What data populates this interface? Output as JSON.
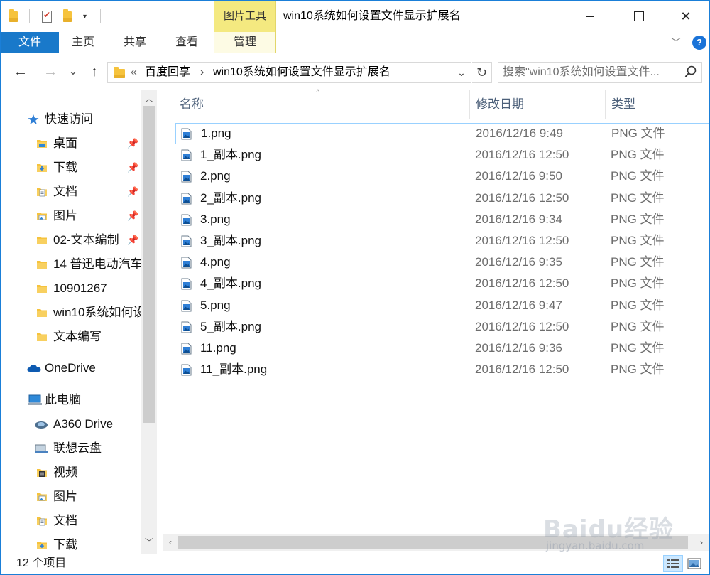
{
  "window": {
    "context_tab_group": "图片工具",
    "title": "win10系统如何设置文件显示扩展名",
    "controls": {
      "close": "✕"
    }
  },
  "ribbon": {
    "tabs": [
      "文件",
      "主页",
      "共享",
      "查看"
    ],
    "context_tab": "管理",
    "expand": "﹀",
    "help": "?"
  },
  "navigation": {
    "back": "←",
    "forward": "→",
    "recent": "⌄",
    "up": "↑",
    "address": {
      "overflow": "«",
      "segments": [
        "百度回享",
        "win10系统如何设置文件显示扩展名"
      ],
      "separator": "›"
    },
    "refresh": "↻",
    "search_placeholder": "搜索\"win10系统如何设置文件...",
    "colors": {
      "accent": "#1979ca",
      "selection_border": "#99d1ff"
    }
  },
  "nav_pane": {
    "quick_access": "快速访问",
    "quick_items": [
      {
        "label": "桌面",
        "pinned": true,
        "icon": "desktop-folder-icon"
      },
      {
        "label": "下载",
        "pinned": true,
        "icon": "download-folder-icon"
      },
      {
        "label": "文档",
        "pinned": true,
        "icon": "documents-folder-icon"
      },
      {
        "label": "图片",
        "pinned": true,
        "icon": "pictures-folder-icon"
      },
      {
        "label": "02-文本编制",
        "pinned": true,
        "icon": "folder-icon"
      },
      {
        "label": "14 普迅电动汽车",
        "pinned": false,
        "icon": "folder-icon"
      },
      {
        "label": "10901267",
        "pinned": false,
        "icon": "folder-icon"
      },
      {
        "label": "win10系统如何设",
        "pinned": false,
        "icon": "folder-icon"
      },
      {
        "label": "文本编写",
        "pinned": false,
        "icon": "folder-icon"
      }
    ],
    "onedrive": "OneDrive",
    "this_pc": "此电脑",
    "pc_items": [
      {
        "label": "A360 Drive",
        "icon": "a360-drive-icon"
      },
      {
        "label": "联想云盘",
        "icon": "lenovo-cloud-icon"
      },
      {
        "label": "视频",
        "icon": "videos-folder-icon"
      },
      {
        "label": "图片",
        "icon": "pictures-folder-icon"
      },
      {
        "label": "文档",
        "icon": "documents-folder-icon"
      },
      {
        "label": "下载",
        "icon": "download-folder-icon"
      }
    ],
    "pin_glyph": "📌"
  },
  "file_list": {
    "columns": [
      "名称",
      "修改日期",
      "类型"
    ],
    "sort_indicator": "^",
    "files": [
      {
        "name": "1.png",
        "date": "2016/12/16 9:49",
        "type": "PNG 文件",
        "selected": true
      },
      {
        "name": "1_副本.png",
        "date": "2016/12/16 12:50",
        "type": "PNG 文件"
      },
      {
        "name": "2.png",
        "date": "2016/12/16 9:50",
        "type": "PNG 文件"
      },
      {
        "name": "2_副本.png",
        "date": "2016/12/16 12:50",
        "type": "PNG 文件"
      },
      {
        "name": "3.png",
        "date": "2016/12/16 9:34",
        "type": "PNG 文件"
      },
      {
        "name": "3_副本.png",
        "date": "2016/12/16 12:50",
        "type": "PNG 文件"
      },
      {
        "name": "4.png",
        "date": "2016/12/16 9:35",
        "type": "PNG 文件"
      },
      {
        "name": "4_副本.png",
        "date": "2016/12/16 12:50",
        "type": "PNG 文件"
      },
      {
        "name": "5.png",
        "date": "2016/12/16 9:47",
        "type": "PNG 文件"
      },
      {
        "name": "5_副本.png",
        "date": "2016/12/16 12:50",
        "type": "PNG 文件"
      },
      {
        "name": "11.png",
        "date": "2016/12/16 9:36",
        "type": "PNG 文件"
      },
      {
        "name": "11_副本.png",
        "date": "2016/12/16 12:50",
        "type": "PNG 文件"
      }
    ]
  },
  "status": {
    "item_count": "12 个项目"
  },
  "watermark": {
    "logo": "Baidu经验",
    "url": "jingyan.baidu.com"
  }
}
